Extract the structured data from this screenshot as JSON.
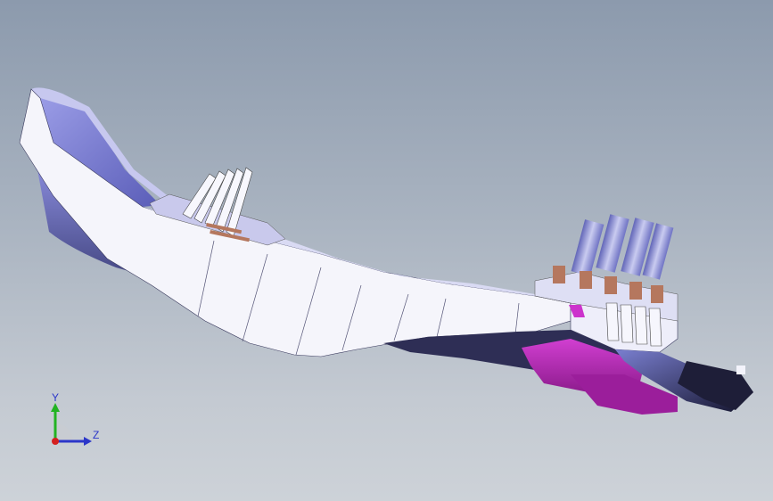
{
  "viewport": {
    "background_top": "#8c9aad",
    "background_bottom": "#cdd2d8"
  },
  "model": {
    "body_color": "#f4f4fb",
    "shadow_color": "#5a5fb0",
    "accent_magenta": "#cc33cc",
    "contact_copper": "#b5775e",
    "dark_tip": "#1e1e38"
  },
  "triad": {
    "y_label": "Y",
    "z_label": "Z",
    "y_color": "#22b322",
    "z_color": "#2b36c9",
    "x_color": "#d42020"
  }
}
